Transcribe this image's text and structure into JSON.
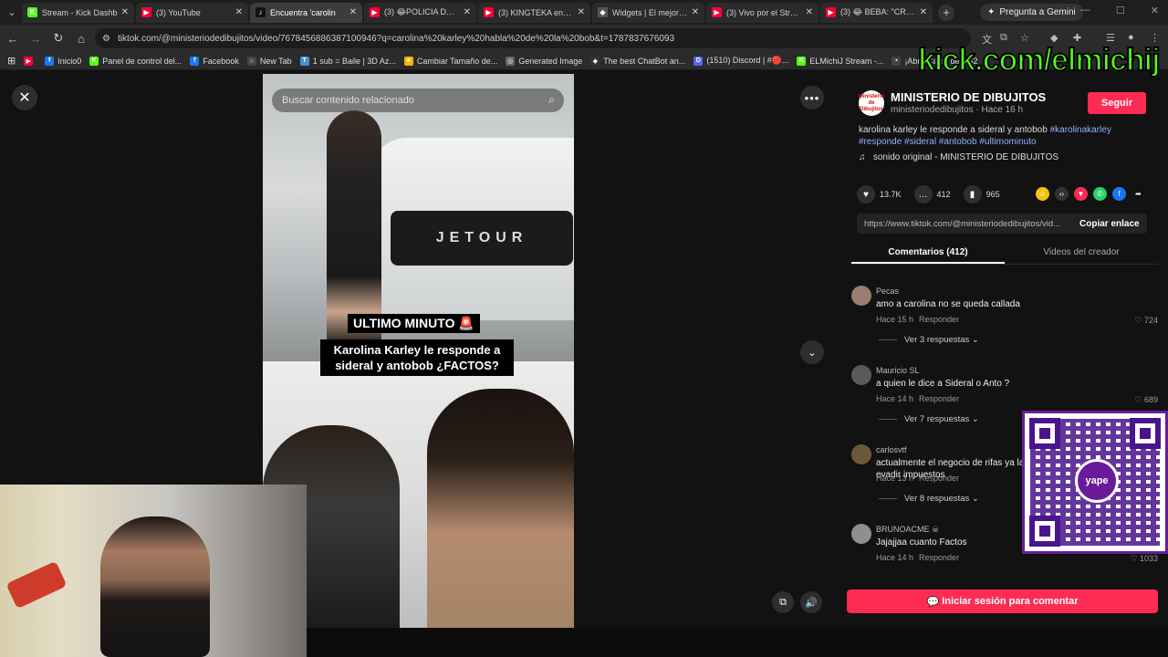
{
  "tabs": [
    {
      "title": "Stream - Kick Dashb",
      "fav": "K",
      "color": "#53fc18"
    },
    {
      "title": "(3) YouTube",
      "fav": "▶",
      "color": "#ff0033"
    },
    {
      "title": "Encuentra 'carolin",
      "fav": "♪",
      "color": "#111111",
      "active": true
    },
    {
      "title": "(3) 😂POLICIA DETIE",
      "fav": "▶",
      "color": "#ff0033"
    },
    {
      "title": "(3) KINGTEKA encuen",
      "fav": "▶",
      "color": "#ff0033"
    },
    {
      "title": "Widgets | El mejor so",
      "fav": "◆",
      "color": "#555555"
    },
    {
      "title": "(3) Vivo por el Stream",
      "fav": "▶",
      "color": "#ff0033"
    },
    {
      "title": "(3) 😂 BEBA: \"CRÉEme",
      "fav": "▶",
      "color": "#ff0033"
    }
  ],
  "gemini_label": "Pregunta a Gemini",
  "url": "tiktok.com/@ministeriodedibujitos/video/7678456886387100946?q=carolina%20karley%20habla%20de%20la%20bob&t=1787837676093",
  "bookmarks": [
    {
      "label": "Inicio0",
      "color": "#1877f2",
      "ic": "f"
    },
    {
      "label": "Panel de control del...",
      "color": "#53fc18",
      "ic": "K"
    },
    {
      "label": "Facebook",
      "color": "#1877f2",
      "ic": "f"
    },
    {
      "label": "New Tab",
      "color": "#444444",
      "ic": "☆"
    },
    {
      "label": "1 sub = Baile | 3D Az...",
      "color": "#4a90d9",
      "ic": "T"
    },
    {
      "label": "Cambiar Tamaño de...",
      "color": "#f4b400",
      "ic": "♣"
    },
    {
      "label": "Generated Image",
      "color": "#666666",
      "ic": "◎"
    },
    {
      "label": "The best ChatBot an...",
      "color": "#333333",
      "ic": "◆"
    },
    {
      "label": "(1510) Discord | #🔴...",
      "color": "#5865f2",
      "ic": "D"
    },
    {
      "label": "ELMichiJ Stream -...",
      "color": "#53fc18",
      "ic": "K"
    },
    {
      "label": "¡Abre Cajas de CS2",
      "color": "#444444",
      "ic": "▪"
    }
  ],
  "video": {
    "search_placeholder": "Buscar contenido relacionado",
    "grill_text": "JETOUR",
    "caption_title": "ULTIMO MINUTO 🚨",
    "caption_body": "Karolina Karley le responde a sideral y antobob ¿FACTOS?"
  },
  "channel": {
    "name": "MINISTERIO DE DIBUJITOS",
    "handle": "ministeriodedibujitos",
    "age": "Hace 16 h",
    "follow_label": "Seguir",
    "avatar_text": "Ministerio de Dibujitos"
  },
  "description": {
    "text": "karolina karley le responde a sideral y antobob ",
    "tags": "#karolinakarley #responde #sideral #antobob #ultimominuto"
  },
  "sound": "sonido original - MINISTERIO DE DIBUJITOS",
  "stats": {
    "likes": "13.7K",
    "comments": "412",
    "saves": "965"
  },
  "link": {
    "url": "https://www.tiktok.com/@ministeriodedibujitos/vid...",
    "copy_label": "Copiar enlace"
  },
  "panel_tabs": {
    "comments": "Comentarios (412)",
    "creator": "Videos del creador"
  },
  "comments": [
    {
      "user": "Pecas",
      "text": "amo a carolina no se queda callada",
      "time": "Hace 15 h",
      "reply": "Responder",
      "likes": "724",
      "replies": "Ver 3 respuestas ⌄",
      "avatar": "#9a7e70"
    },
    {
      "user": "Mauricio SL",
      "text": "a quien le dice a Sideral o Anto ?",
      "time": "Hace 14 h",
      "reply": "Responder",
      "likes": "689",
      "replies": "Ver 7 respuestas ⌄",
      "avatar": "#5a5a5a"
    },
    {
      "user": "carlosvtf",
      "text": "actualmente el negocio de rifas ya lavanderia para evadir impuestos",
      "time": "Hace 13 h",
      "reply": "Responder",
      "likes": "",
      "replies": "Ver 8 respuestas ⌄",
      "avatar": "#6b5a3a"
    },
    {
      "user": "BRUNOACME ☠",
      "text": "Jajajjaa cuanto Factos",
      "time": "Hace 14 h",
      "reply": "Responder",
      "likes": "1033",
      "replies": "",
      "avatar": "#8f8f8f"
    }
  ],
  "login_label": "Iniciar sesión para comentar",
  "overlay": {
    "kick_text": "kick.com/elmichij",
    "yape_text": "yape"
  }
}
